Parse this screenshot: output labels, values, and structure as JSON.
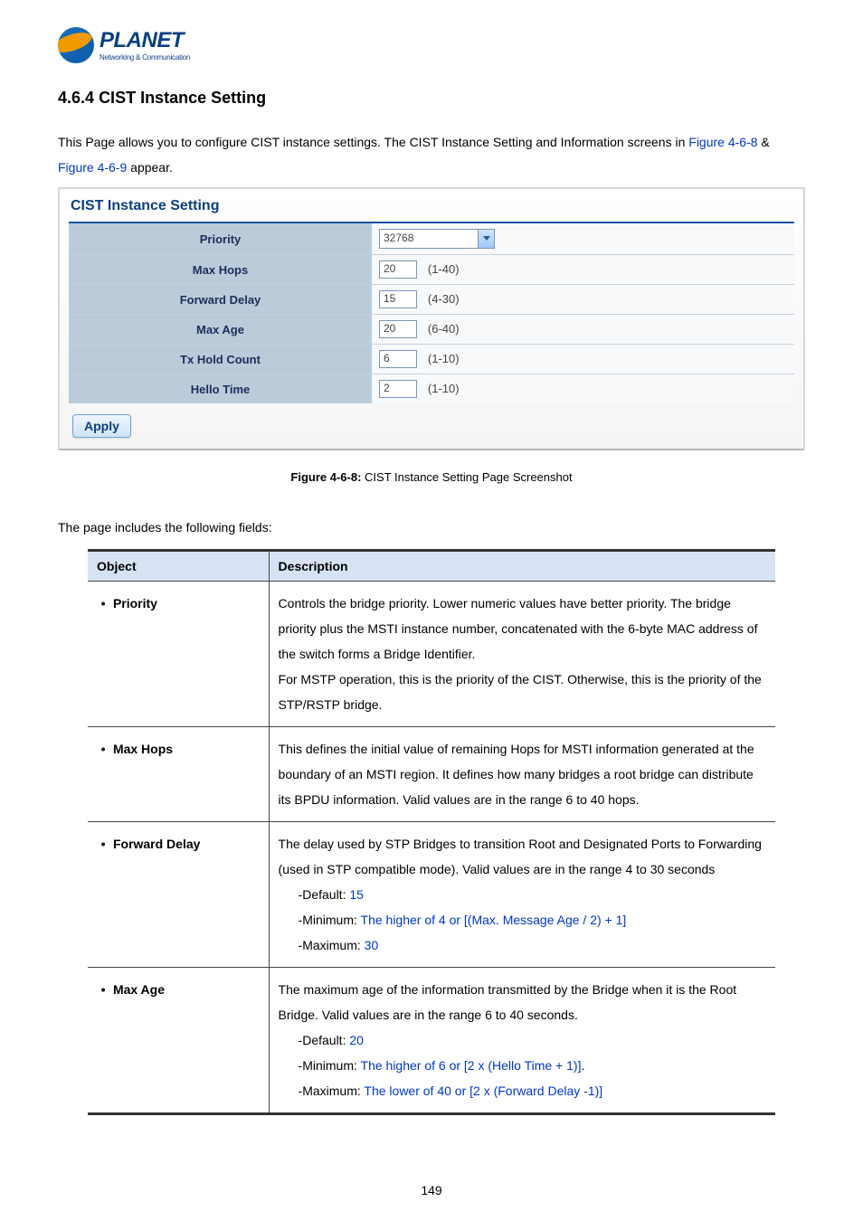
{
  "logo": {
    "name": "PLANET",
    "tagline": "Networking & Communication"
  },
  "section": {
    "number": "4.6.4",
    "title": "CIST Instance Setting"
  },
  "intro": {
    "pre": "This Page allows you to configure CIST instance settings. The CIST Instance Setting and Information screens in ",
    "link1": "Figure 4-6-8",
    "amp": " & ",
    "link2": "Figure 4-6-9",
    "post": " appear."
  },
  "panel": {
    "title": "CIST Instance Setting",
    "rows": [
      {
        "label": "Priority",
        "type": "select",
        "value": "32768",
        "range": ""
      },
      {
        "label": "Max Hops",
        "type": "input",
        "value": "20",
        "range": "(1-40)"
      },
      {
        "label": "Forward Delay",
        "type": "input",
        "value": "15",
        "range": "(4-30)"
      },
      {
        "label": "Max Age",
        "type": "input",
        "value": "20",
        "range": "(6-40)"
      },
      {
        "label": "Tx Hold Count",
        "type": "input",
        "value": "6",
        "range": "(1-10)"
      },
      {
        "label": "Hello Time",
        "type": "input",
        "value": "2",
        "range": "(1-10)"
      }
    ],
    "apply": "Apply"
  },
  "figure": {
    "label": "Figure 4-6-8:",
    "caption": " CIST Instance Setting Page Screenshot"
  },
  "leadin": "The page includes the following fields:",
  "fields_table": {
    "headers": {
      "obj": "Object",
      "desc": "Description"
    },
    "rows": [
      {
        "obj": "Priority",
        "desc_plain": [
          "Controls the bridge priority. Lower numeric values have better priority. The bridge priority plus the MSTI instance number, concatenated with the 6-byte MAC address of the switch forms a Bridge Identifier.",
          "For MSTP operation, this is the priority of the CIST. Otherwise, this is the priority of the STP/RSTP bridge."
        ]
      },
      {
        "obj": "Max Hops",
        "desc_plain": [
          "This defines the initial value of remaining Hops for MSTI information generated at the boundary of an MSTI region. It defines how many bridges a root bridge can distribute its BPDU information. Valid values are in the range 6 to 40 hops."
        ]
      },
      {
        "obj": "Forward Delay",
        "desc_plain": [
          "The delay used by STP Bridges to transition Root and Designated Ports to Forwarding (used in STP compatible mode). Valid values are in the range 4 to 30 seconds"
        ],
        "defaults": {
          "default_label": "-Default: ",
          "default_val": "15",
          "min_label": "-Minimum: ",
          "min_val": "The higher of 4 or [(Max. Message Age / 2) + 1]",
          "max_label": "-Maximum: ",
          "max_val": "30"
        }
      },
      {
        "obj": "Max Age",
        "desc_plain": [
          "The maximum age of the information transmitted by the Bridge when it is the Root Bridge. Valid values are in the range 6 to 40 seconds."
        ],
        "defaults": {
          "default_label": "-Default: ",
          "default_val": "20",
          "min_label": "-Minimum: ",
          "min_val": "The higher of 6 or [2 x (Hello Time + 1)]",
          "min_trail": ".",
          "max_label": "-Maximum: ",
          "max_val": "The lower of 40 or [2 x (Forward Delay -1)]"
        }
      }
    ]
  },
  "page_number": "149"
}
